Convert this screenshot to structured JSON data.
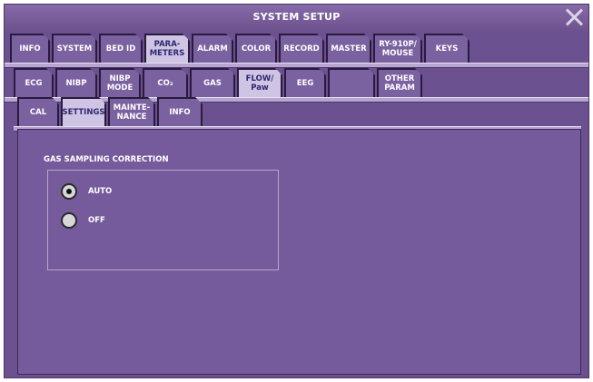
{
  "window": {
    "title": "SYSTEM SETUP"
  },
  "tabs_row1": [
    {
      "label": "INFO",
      "selected": false
    },
    {
      "label": "SYSTEM",
      "selected": false
    },
    {
      "label": "BED ID",
      "selected": false
    },
    {
      "label": "PARA-\nMETERS",
      "selected": true
    },
    {
      "label": "ALARM",
      "selected": false
    },
    {
      "label": "COLOR",
      "selected": false
    },
    {
      "label": "RECORD",
      "selected": false
    },
    {
      "label": "MASTER",
      "selected": false
    },
    {
      "label": "RY-910P/\nMOUSE",
      "selected": false
    },
    {
      "label": "KEYS",
      "selected": false
    }
  ],
  "tabs_row2": [
    {
      "label": "ECG",
      "selected": false
    },
    {
      "label": "NIBP",
      "selected": false
    },
    {
      "label": "NIBP\nMODE",
      "selected": false
    },
    {
      "label": "CO₂",
      "selected": false
    },
    {
      "label": "GAS",
      "selected": false
    },
    {
      "label": "FLOW/\nPaw",
      "selected": true
    },
    {
      "label": "EEG",
      "selected": false
    },
    {
      "label": "",
      "selected": false
    },
    {
      "label": "OTHER\nPARAM",
      "selected": false
    }
  ],
  "tabs_row3": [
    {
      "label": "CAL",
      "selected": false
    },
    {
      "label": "SETTINGS",
      "selected": true
    },
    {
      "label": "MAINTE-\nNANCE",
      "selected": false
    },
    {
      "label": "INFO",
      "selected": false
    }
  ],
  "gas_sampling": {
    "title": "GAS SAMPLING CORRECTION",
    "options": [
      {
        "label": "AUTO",
        "checked": true
      },
      {
        "label": "OFF",
        "checked": false
      }
    ]
  }
}
